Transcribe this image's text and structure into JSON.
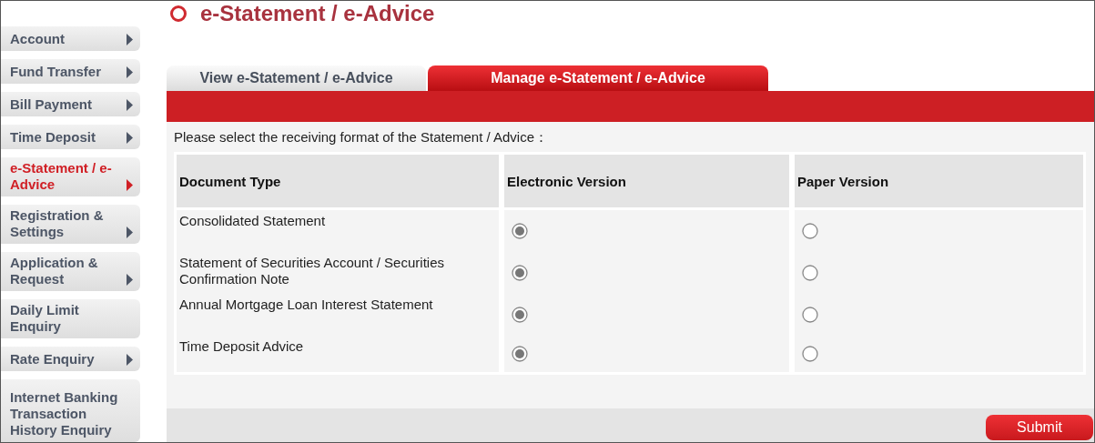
{
  "sidebar": {
    "items": [
      {
        "label": "Account",
        "selected": false,
        "arrow": true
      },
      {
        "label": "Fund Transfer",
        "selected": false,
        "arrow": true
      },
      {
        "label": "Bill Payment",
        "selected": false,
        "arrow": true
      },
      {
        "label": "Time Deposit",
        "selected": false,
        "arrow": true
      },
      {
        "label": "e-Statement / e-Advice",
        "selected": true,
        "arrow": true
      },
      {
        "label": "Registration & Settings",
        "selected": false,
        "arrow": true
      },
      {
        "label": "Application & Request",
        "selected": false,
        "arrow": true
      },
      {
        "label": "Daily Limit Enquiry",
        "selected": false,
        "arrow": false
      },
      {
        "label": "Rate Enquiry",
        "selected": false,
        "arrow": true
      },
      {
        "label": "Internet Banking Transaction History Enquiry",
        "selected": false,
        "arrow": false
      }
    ]
  },
  "page_title": "e-Statement / e-Advice",
  "tabs": [
    {
      "label": "View e-Statement / e-Advice",
      "selected": false
    },
    {
      "label": "Manage e-Statement / e-Advice",
      "selected": true
    }
  ],
  "instruction": "Please select the receiving format of the Statement / Advice：",
  "table": {
    "columns": [
      "Document Type",
      "Electronic Version",
      "Paper Version"
    ],
    "rows": [
      {
        "document_type": "Consolidated Statement",
        "options": [
          {
            "selected": true
          },
          {
            "selected": false
          }
        ]
      },
      {
        "document_type": "Statement of Securities Account / Securities Confirmation Note",
        "options": [
          {
            "selected": true
          },
          {
            "selected": false
          }
        ]
      },
      {
        "document_type": "Annual Mortgage Loan Interest Statement",
        "options": [
          {
            "selected": true
          },
          {
            "selected": false
          }
        ]
      },
      {
        "document_type": "Time Deposit Advice",
        "options": [
          {
            "selected": true
          },
          {
            "selected": false
          }
        ]
      }
    ]
  },
  "submit_button": "Submit"
}
